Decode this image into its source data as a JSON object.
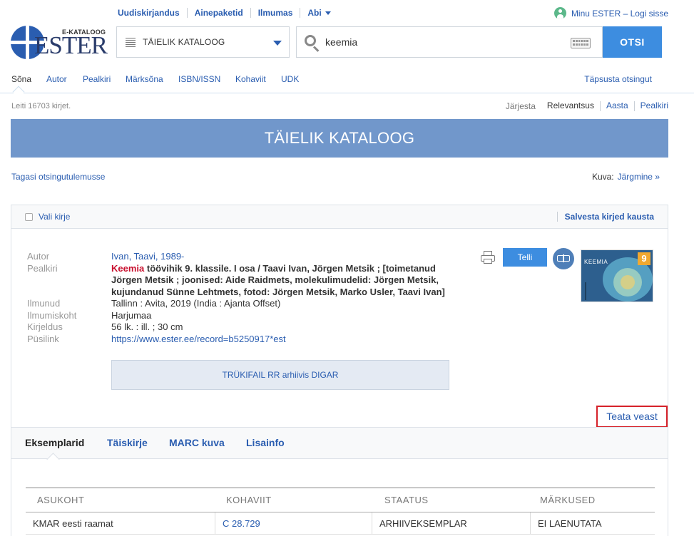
{
  "topnav": {
    "items": [
      "Uudiskirjandus",
      "Ainepaketid",
      "Ilmumas",
      "Abi"
    ]
  },
  "user": {
    "label": "Minu ESTER – Logi sisse"
  },
  "logo": {
    "small": "E-KATALOOG",
    "big": "ESTER"
  },
  "catalog_select": {
    "value": "TÄIELIK KATALOOG"
  },
  "search": {
    "value": "keemia",
    "button": "OTSI"
  },
  "search_tabs": {
    "items": [
      "Sõna",
      "Autor",
      "Pealkiri",
      "Märksõna",
      "ISBN/ISSN",
      "Kohaviit",
      "UDK"
    ],
    "refine": "Täpsusta otsingut"
  },
  "results": {
    "found": "Leiti 16703 kirjet."
  },
  "sort": {
    "label": "Järjesta",
    "options": [
      "Relevantsus",
      "Aasta",
      "Pealkiri"
    ]
  },
  "banner": {
    "title": "TÄIELIK KATALOOG"
  },
  "nav": {
    "back": "Tagasi otsingutulemusse",
    "view_label": "Kuva:",
    "next": "Järgmine »"
  },
  "record": {
    "select_label": "Vali kirje",
    "save_folder": "Salvesta kirjed kausta",
    "fields": {
      "author_k": "Autor",
      "author_v": "Ivan, Taavi, 1989-",
      "title_k": "Pealkiri",
      "title_hl": "Keemia",
      "title_rest": " töövihik 9. klassile. I osa / Taavi Ivan, Jörgen Metsik ; [toimetanud Jörgen Metsik ; joonised: Aide Raidmets, molekulimudelid: Jörgen Metsik, kujundanud Sünne Lehtmets, fotod: Jörgen Metsik, Marko Usler, Taavi Ivan]",
      "pub_k": "Ilmunud",
      "pub_v": "Tallinn : Avita, 2019 (India : Ajanta Offset)",
      "place_k": "Ilmumiskoht",
      "place_v": "Harjumaa",
      "desc_k": "Kirjeldus",
      "desc_v": "56 lk. : ill. ; 30 cm",
      "link_k": "Püsilink",
      "link_v": "https://www.ester.ee/record=b5250917*est"
    },
    "digar": "TRÜKIFAIL RR arhiivis DIGAR",
    "order": "Telli",
    "cover": {
      "title": "KEEMIA",
      "number": "9"
    },
    "report": "Teata veast"
  },
  "detail_tabs": [
    "Eksemplarid",
    "Täiskirje",
    "MARC kuva",
    "Lisainfo"
  ],
  "holdings": {
    "columns": [
      "ASUKOHT",
      "KOHAVIIT",
      "STAATUS",
      "MÄRKUSED"
    ],
    "rows": [
      [
        "KMAR eesti raamat",
        "C 28.729",
        "ARHIIVEKSEMPLAR",
        "EI LAENUTATA"
      ]
    ]
  },
  "colors": {
    "accent": "#3d8de0",
    "banner": "#7197cb",
    "link": "#2a5db0",
    "highlight": "#c8102e",
    "report_border": "#d6222a"
  }
}
